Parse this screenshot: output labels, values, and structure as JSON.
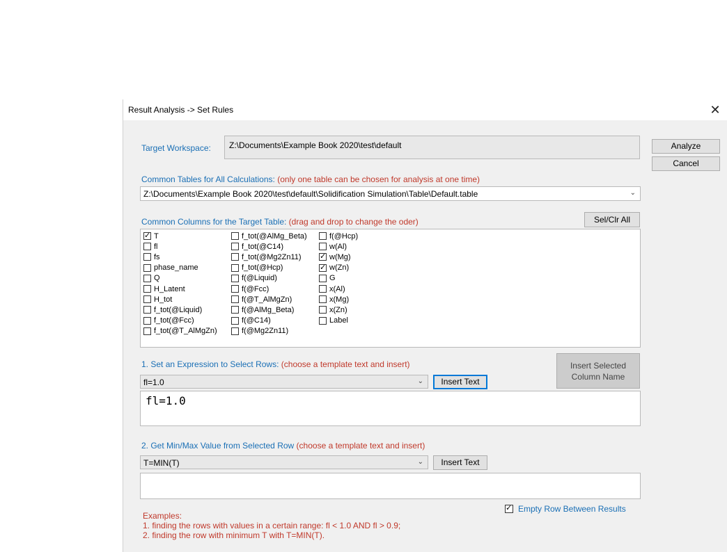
{
  "dialog": {
    "title": "Result Analysis -> Set Rules",
    "close_label": "✕"
  },
  "workspace": {
    "label": "Target Workspace:",
    "value": "Z:\\Documents\\Example Book 2020\\test\\default"
  },
  "buttons": {
    "analyze": "Analyze",
    "cancel": "Cancel",
    "sel_clr_all": "Sel/Clr All",
    "insert_selected_line1": "Insert Selected",
    "insert_selected_line2": "Column Name",
    "insert_text_1": "Insert Text",
    "insert_text_2": "Insert Text"
  },
  "tables": {
    "label": "Common Tables for All Calculations:",
    "note": "(only one table can be chosen for analysis at one time)",
    "selected": "Z:\\Documents\\Example Book 2020\\test\\default\\Solidification Simulation\\Table\\Default.table"
  },
  "columns": {
    "label": "Common Columns for the Target Table:",
    "note": "(drag and drop to change the oder)",
    "col1": [
      {
        "name": "T",
        "checked": true
      },
      {
        "name": "fl",
        "checked": false
      },
      {
        "name": "fs",
        "checked": false
      },
      {
        "name": "phase_name",
        "checked": false
      },
      {
        "name": "Q",
        "checked": false
      },
      {
        "name": "H_Latent",
        "checked": false
      },
      {
        "name": "H_tot",
        "checked": false
      },
      {
        "name": "f_tot(@Liquid)",
        "checked": false
      },
      {
        "name": "f_tot(@Fcc)",
        "checked": false
      },
      {
        "name": "f_tot(@T_AlMgZn)",
        "checked": false
      }
    ],
    "col2": [
      {
        "name": "f_tot(@AlMg_Beta)",
        "checked": false
      },
      {
        "name": "f_tot(@C14)",
        "checked": false
      },
      {
        "name": "f_tot(@Mg2Zn11)",
        "checked": false
      },
      {
        "name": "f_tot(@Hcp)",
        "checked": false
      },
      {
        "name": "f(@Liquid)",
        "checked": false
      },
      {
        "name": "f(@Fcc)",
        "checked": false
      },
      {
        "name": "f(@T_AlMgZn)",
        "checked": false
      },
      {
        "name": "f(@AlMg_Beta)",
        "checked": false
      },
      {
        "name": "f(@C14)",
        "checked": false
      },
      {
        "name": "f(@Mg2Zn11)",
        "checked": false
      }
    ],
    "col3": [
      {
        "name": "f(@Hcp)",
        "checked": false
      },
      {
        "name": "w(Al)",
        "checked": false
      },
      {
        "name": "w(Mg)",
        "checked": true
      },
      {
        "name": "w(Zn)",
        "checked": true
      },
      {
        "name": "G",
        "checked": false
      },
      {
        "name": "x(Al)",
        "checked": false
      },
      {
        "name": "x(Mg)",
        "checked": false
      },
      {
        "name": "x(Zn)",
        "checked": false
      },
      {
        "name": "Label",
        "checked": false
      }
    ]
  },
  "step1": {
    "label": "1. Set an Expression to Select Rows:",
    "note": "(choose a template text and insert)",
    "template": "fl=1.0",
    "expression": "fl=1.0"
  },
  "step2": {
    "label": "2. Get Min/Max Value from Selected Row",
    "note": "(choose a template text and insert)",
    "template": "T=MIN(T)",
    "expression": ""
  },
  "options": {
    "empty_row_label": "Empty Row Between Results",
    "empty_row_checked": true
  },
  "examples": {
    "title": "Examples:",
    "line1": "1. finding the rows with values in a certain range: fl < 1.0 AND fl > 0.9;",
    "line2": "2. finding the row with minimum T with T=MIN(T)."
  }
}
